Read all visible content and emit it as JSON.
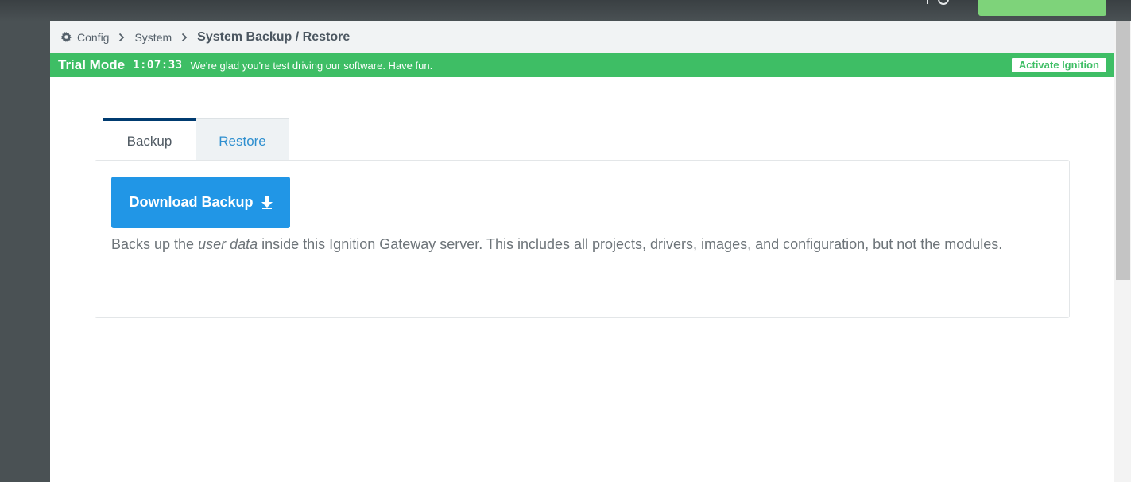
{
  "breadcrumb": {
    "items": [
      "Config",
      "System"
    ],
    "current": "System Backup / Restore"
  },
  "trial": {
    "mode_label": "Trial Mode",
    "timer": "1:07:33",
    "message": "We're glad you're test driving our software. Have fun.",
    "activate_label": "Activate Ignition"
  },
  "tabs": [
    {
      "label": "Backup",
      "active": true
    },
    {
      "label": "Restore",
      "active": false
    }
  ],
  "backup": {
    "download_label": "Download Backup",
    "description_pre": "Backs up the ",
    "description_em": "user data",
    "description_post": " inside this Ignition Gateway server. This includes all projects, drivers, images, and configuration, but not the modules."
  },
  "colors": {
    "trial_green": "#3ebe65",
    "primary_blue": "#2196e6",
    "tab_accent": "#003b70",
    "sidebar": "#4a5154"
  },
  "icons": {
    "breadcrumb_root": "gear-icon",
    "separator": "chevron-right-icon",
    "download": "arrow-down-icon"
  }
}
